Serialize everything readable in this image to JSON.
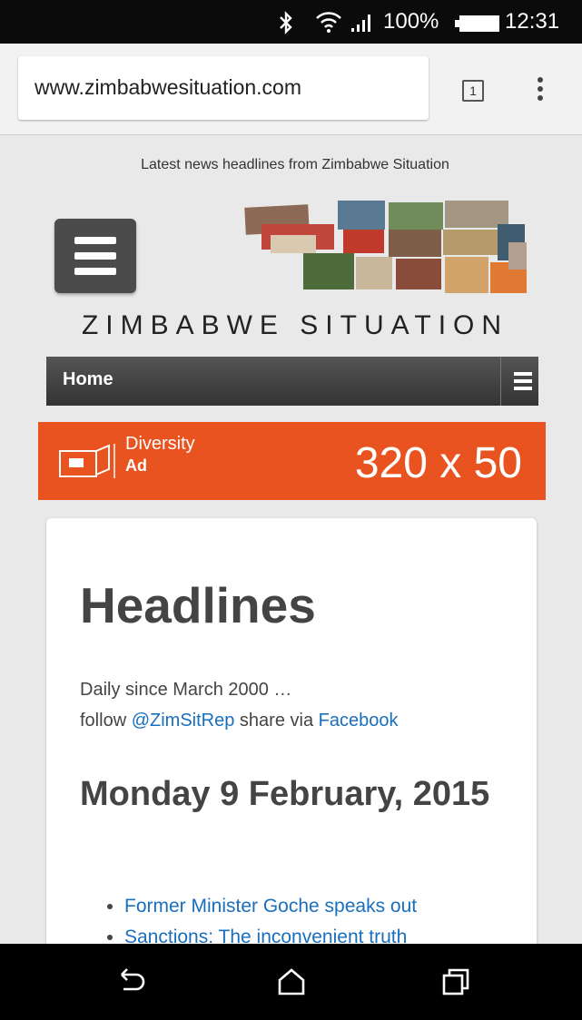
{
  "status_bar": {
    "battery": "100%",
    "time": "12:31"
  },
  "browser": {
    "url": "www.zimbabwesituation.com",
    "tab_count": "1"
  },
  "site": {
    "tagline": "Latest news headlines from Zimbabwe Situation",
    "name": "ZIMBABWE SITUATION",
    "nav_home": "Home"
  },
  "ad": {
    "brand_line1": "Diversity",
    "brand_line2": "Ad",
    "size_text": "320 x 50",
    "color": "#e8531f"
  },
  "content": {
    "heading": "Headlines",
    "intro": "Daily since March 2000 …",
    "follow_prefix": "follow ",
    "follow_handle": "@ZimSitRep",
    "share_text": " share via ",
    "share_link": "Facebook",
    "date_heading": "Monday 9 February, 2015",
    "headlines": [
      "Former Minister Goche speaks out",
      "Sanctions: The inconvenient truth"
    ]
  },
  "icons": {
    "status": [
      "bluetooth-icon",
      "wifi-icon",
      "signal-icon",
      "battery-icon"
    ],
    "system_nav": [
      "back-icon",
      "home-icon",
      "recents-icon"
    ]
  }
}
